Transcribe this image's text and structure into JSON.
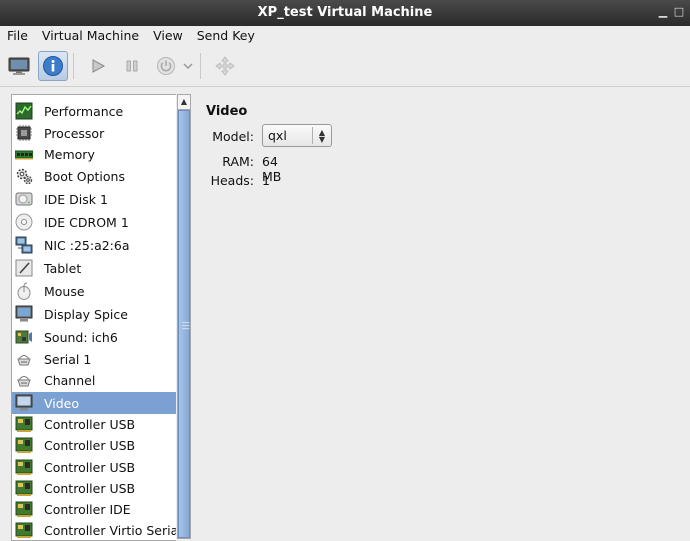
{
  "window": {
    "title": "XP_test Virtual Machine"
  },
  "menubar": [
    "File",
    "Virtual Machine",
    "View",
    "Send Key"
  ],
  "toolbar": {
    "buttons": [
      "console-view-icon",
      "details-view-icon",
      "run-icon",
      "pause-icon",
      "power-icon",
      "power-dropdown-icon",
      "fullscreen-icon"
    ],
    "active": "details-view-icon"
  },
  "hardware_list": {
    "selected": "Video",
    "items": [
      "Performance",
      "Processor",
      "Memory",
      "Boot Options",
      "IDE Disk 1",
      "IDE CDROM 1",
      "NIC :25:a2:6a",
      "Tablet",
      "Mouse",
      "Display Spice",
      "Sound: ich6",
      "Serial 1",
      "Channel",
      "Video",
      "Controller USB",
      "Controller USB",
      "Controller USB",
      "Controller USB",
      "Controller IDE",
      "Controller Virtio Serial"
    ]
  },
  "details": {
    "title": "Video",
    "model_label": "Model:",
    "model_value": "qxl",
    "ram_label": "RAM:",
    "ram_value": "64 MB",
    "heads_label": "Heads:",
    "heads_value": "1"
  },
  "colors": {
    "selection": "#7aa1d2",
    "titlebar": "#2e2e2e"
  }
}
